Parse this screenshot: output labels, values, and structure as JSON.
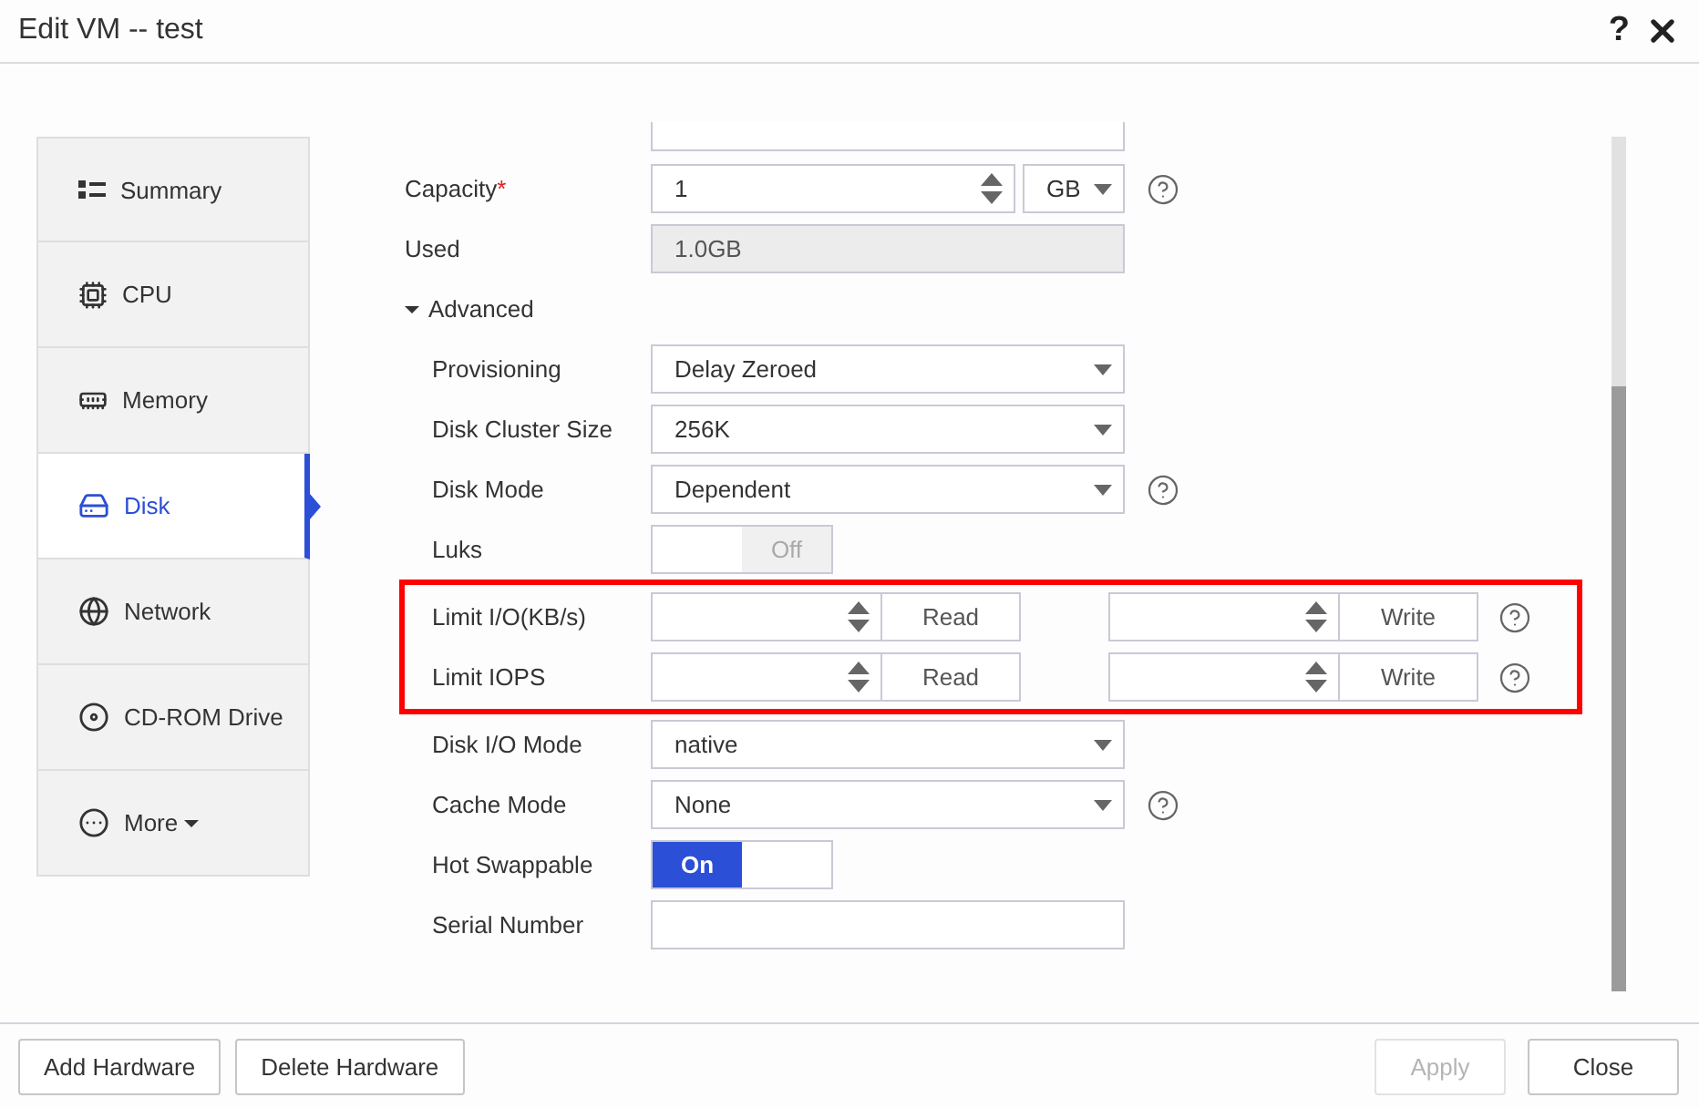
{
  "window": {
    "title": "Edit VM -- test",
    "help": "?"
  },
  "sidebar": {
    "items": [
      {
        "label": "Summary",
        "selected": false,
        "dropdown": false
      },
      {
        "label": "CPU",
        "selected": false,
        "dropdown": false
      },
      {
        "label": "Memory",
        "selected": false,
        "dropdown": false
      },
      {
        "label": "Disk",
        "selected": true,
        "dropdown": false
      },
      {
        "label": "Network",
        "selected": false,
        "dropdown": false
      },
      {
        "label": "CD-ROM Drive",
        "selected": false,
        "dropdown": false
      },
      {
        "label": "More",
        "selected": false,
        "dropdown": true
      }
    ]
  },
  "form": {
    "rows": [
      {
        "kind": "cut"
      },
      {
        "kind": "number_unit",
        "label": "Capacity",
        "required_mark": "*",
        "value": "1",
        "unit": "GB",
        "help": true
      },
      {
        "kind": "readonly",
        "label": "Used",
        "value": "1.0GB"
      },
      {
        "kind": "section",
        "label": "Advanced",
        "expanded": true,
        "children": [
          {
            "kind": "select",
            "label": "Provisioning",
            "value": "Delay Zeroed",
            "help": false
          },
          {
            "kind": "select",
            "label": "Disk Cluster Size",
            "value": "256K",
            "help": false
          },
          {
            "kind": "select",
            "label": "Disk Mode",
            "value": "Dependent",
            "help": true
          },
          {
            "kind": "toggle",
            "label": "Luks",
            "on": false,
            "text": "Off"
          },
          {
            "kind": "highlight",
            "children": [
              {
                "kind": "limit",
                "label": "Limit I/O(KB/s)",
                "read": "Read",
                "write": "Write",
                "help": true
              },
              {
                "kind": "limit",
                "label": "Limit IOPS",
                "read": "Read",
                "write": "Write",
                "help": true
              }
            ]
          },
          {
            "kind": "select",
            "label": "Disk I/O Mode",
            "value": "native",
            "help": false
          },
          {
            "kind": "select",
            "label": "Cache Mode",
            "value": "None",
            "help": true
          },
          {
            "kind": "toggle",
            "label": "Hot Swappable",
            "on": true,
            "text": "On"
          },
          {
            "kind": "text",
            "label": "Serial Number"
          }
        ]
      }
    ]
  },
  "footer": {
    "left_buttons": [
      {
        "label": "Add Hardware",
        "disabled": false
      },
      {
        "label": "Delete Hardware",
        "disabled": false
      }
    ],
    "right_buttons": [
      {
        "label": "Apply",
        "disabled": true
      },
      {
        "label": "Close",
        "disabled": false
      }
    ]
  }
}
